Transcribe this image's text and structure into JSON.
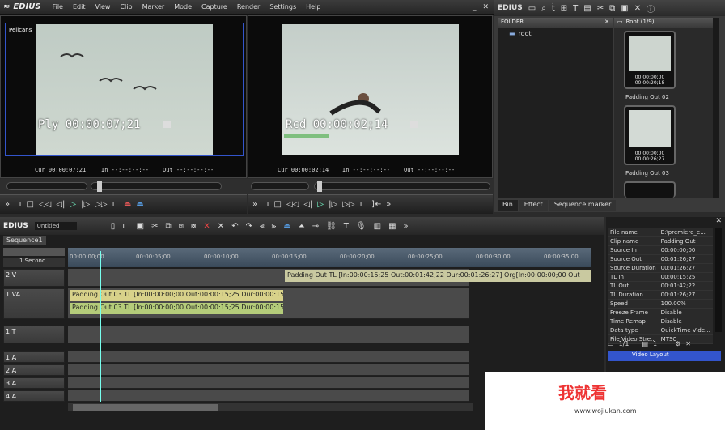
{
  "menubar": {
    "app": "EDIUS",
    "items": [
      "File",
      "Edit",
      "View",
      "Clip",
      "Marker",
      "Mode",
      "Capture",
      "Render",
      "Settings",
      "Help"
    ]
  },
  "player": {
    "label": "Pelicans",
    "timecode": "Ply 00:00:07;21",
    "cur": "Cur 00:00:07;21",
    "in": "In --:--:--;--",
    "out": "Out --:--:--;--"
  },
  "recorder": {
    "timecode": "Rcd 00:00:02;14",
    "cur": "Cur 00:00:02;14",
    "in": "In --:--:--;--",
    "out": "Out --:--:--;--"
  },
  "bin": {
    "title": "EDIUS",
    "folder_header": "FOLDER",
    "folder_root": "root",
    "list_header": "Root (1/9)",
    "clips": [
      {
        "tc": "00:00:00;00\n00:00:20;18",
        "name": "Padding Out 02"
      },
      {
        "tc": "00:00:00;00\n00:00:26;27",
        "name": "Padding Out 03"
      }
    ],
    "tabs": [
      "Bin",
      "Effect",
      "Sequence marker"
    ]
  },
  "timeline": {
    "title": "EDIUS",
    "project": "Untitled",
    "sequence_tab": "Sequence1",
    "scale": "1 Second",
    "ruler": [
      "00:00:00;00",
      "00:00:05;00",
      "00:00:10;00",
      "00:00:15;00",
      "00:00:20;00",
      "00:00:25;00",
      "00:00:30;00",
      "00:00:35;00"
    ],
    "tracks": [
      "2 V",
      "1 VA",
      "1 T",
      "1 A",
      "2 A",
      "3 A",
      "4 A"
    ],
    "clip_v2": "Padding Out  TL [In:00:00:15;25 Out:00:01:42;22 Dur:00:01:26;27]  Org[In:00:00:00;00 Out",
    "clip_va1": "Padding Out 03  TL [In:00:00:00;00 Out:00:00:15;25 Dur:00:00:15;25]",
    "clip_va1_audio": "Padding Out 03  TL [In:00:00:00;00 Out:00:00:15;25 Dur:00:00:15;25]"
  },
  "properties": [
    [
      "File name",
      "E:\\premiere_e..."
    ],
    [
      "Clip name",
      "Padding Out"
    ],
    [
      "Source In",
      "00:00:00;00"
    ],
    [
      "Source Out",
      "00:01:26;27"
    ],
    [
      "Source Duration",
      "00:01:26;27"
    ],
    [
      "TL In",
      "00:00:15;25"
    ],
    [
      "TL Out",
      "00:01:42;22"
    ],
    [
      "TL Duration",
      "00:01:26;27"
    ],
    [
      "Speed",
      "100.00%"
    ],
    [
      "Freeze Frame",
      "Disable"
    ],
    [
      "Time Remap",
      "Disable"
    ],
    [
      "Data type",
      "QuickTime Vide..."
    ],
    [
      "File Video Stre...",
      "MTSC"
    ]
  ],
  "info_panel": {
    "count": "1/1",
    "count2": "1",
    "layout_item": "Video Layout"
  },
  "watermark": {
    "text": "我就看",
    "url": "www.wojiukan.com"
  },
  "colors": {
    "accent": "#3355cc",
    "clip_yellow": "#d8d28a",
    "clip_green": "#b4cc7a",
    "clip_v2": "#c9c9a0"
  }
}
